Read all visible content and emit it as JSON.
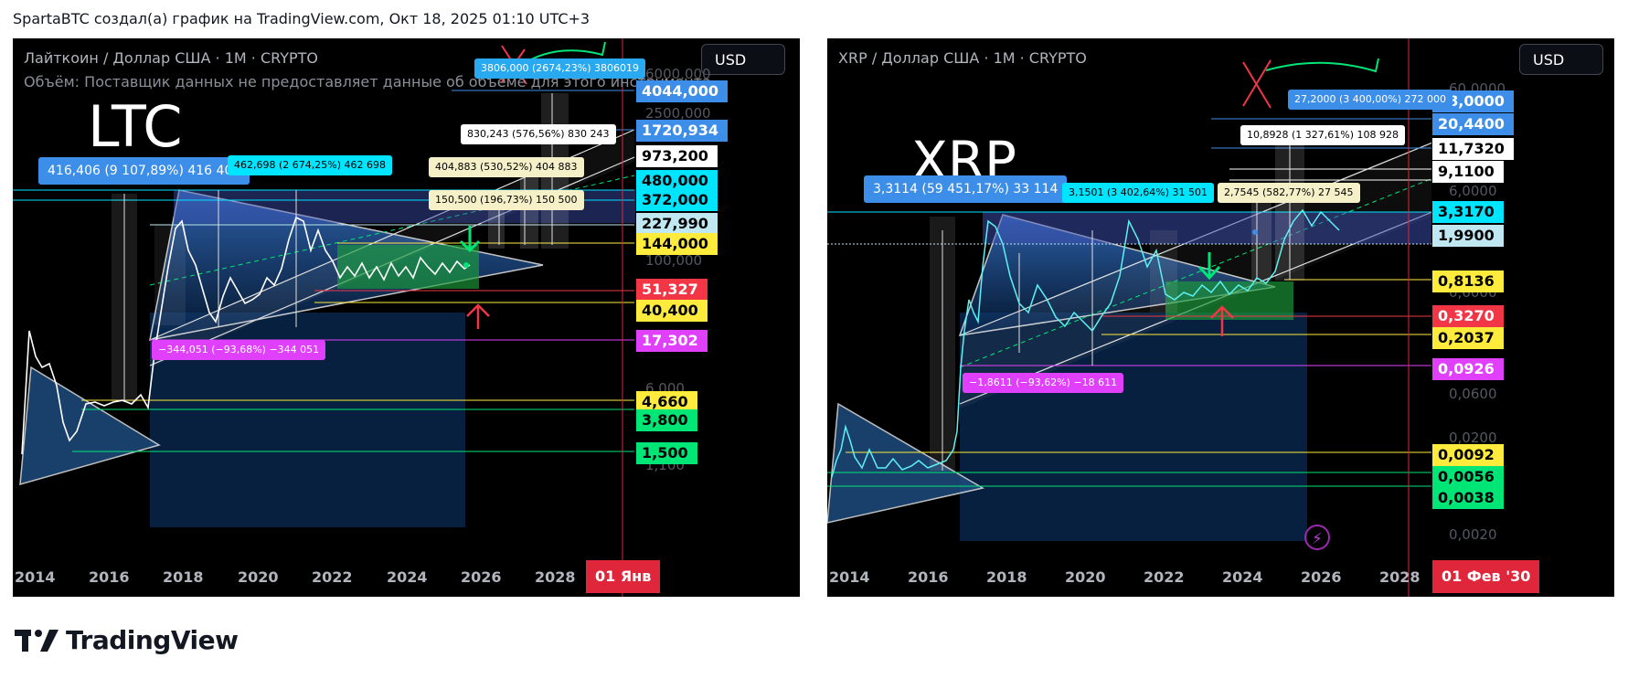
{
  "header": {
    "text": "SpartaBTC создал(а) график на TradingView.com, Окт 18, 2025 01:10 UTC+3"
  },
  "footer": {
    "brand": "TradingView",
    "logo_icon": "tradingview-logo-icon"
  },
  "colors": {
    "blue_tag": "#3d8ee8",
    "cyan_tag": "#00e5ff",
    "white_tag": "#ffffff",
    "light_cyan_tag": "#bfe8f3",
    "yellow_tag": "#ffeb3b",
    "red_tag": "#f23645",
    "green_tag": "#00e676",
    "magenta_tag": "#e040fb",
    "date_red": "#e0263b"
  },
  "ltc": {
    "symbol": "Лайткоин / Доллар США · 1M · CRYPTO",
    "volume_info": "Объём: Поставщик данных не предоставляет данные об объеме для этого инструмента.",
    "big_label": "LTC",
    "currency": "USD",
    "price_tags": [
      {
        "value": "4044,000",
        "style": "blue"
      },
      {
        "value": "1720,934",
        "style": "blue"
      },
      {
        "value": "973,200",
        "style": "white"
      },
      {
        "value": "480,000",
        "style": "cyan"
      },
      {
        "value": "372,000",
        "style": "cyan"
      },
      {
        "value": "227,990",
        "style": "lightcyan"
      },
      {
        "value": "144,000",
        "style": "yellow"
      },
      {
        "value": "51,327",
        "style": "red"
      },
      {
        "value": "40,400",
        "style": "yellow"
      },
      {
        "value": "17,302",
        "style": "magenta"
      },
      {
        "value": "4,660",
        "style": "yellow"
      },
      {
        "value": "3,800",
        "style": "green"
      },
      {
        "value": "1,500",
        "style": "green"
      }
    ],
    "axis_ticks": [
      "6000,000",
      "2500,000",
      "100,000",
      "6,000",
      "1,100"
    ],
    "years": [
      "2014",
      "2016",
      "2018",
      "2020",
      "2022",
      "2024",
      "2026",
      "2028"
    ],
    "date_marker": "01 Янв",
    "badges": [
      {
        "text": "416,406 (9 107,89%) 416 406",
        "style": "blue",
        "size": "big"
      },
      {
        "text": "462,698 (2 674,25%) 462 698",
        "style": "cyan"
      },
      {
        "text": "830,243 (576,56%) 830 243",
        "style": "white"
      },
      {
        "text": "404,883 (530,52%) 404 883",
        "style": "cream"
      },
      {
        "text": "150,500 (196,73%) 150 500",
        "style": "cream"
      },
      {
        "text": "3806,000 (2674,23%) 3806019",
        "style": "cyan"
      },
      {
        "text": "−344,051 (−93,68%) −344 051",
        "style": "magenta"
      }
    ]
  },
  "xrp": {
    "symbol": "XRP / Доллар США · 1M · CRYPTO",
    "big_label": "XRP",
    "currency": "USD",
    "price_tags": [
      {
        "value": "28,0000",
        "style": "blue"
      },
      {
        "value": "20,4400",
        "style": "blue"
      },
      {
        "value": "11,7320",
        "style": "white"
      },
      {
        "value": "9,1100",
        "style": "white"
      },
      {
        "value": "3,3170",
        "style": "cyan"
      },
      {
        "value": "1,9900",
        "style": "lightcyan"
      },
      {
        "value": "0,8136",
        "style": "yellow"
      },
      {
        "value": "0,3270",
        "style": "red"
      },
      {
        "value": "0,2037",
        "style": "yellow"
      },
      {
        "value": "0,0926",
        "style": "magenta"
      },
      {
        "value": "0,0092",
        "style": "yellow"
      },
      {
        "value": "0,0056",
        "style": "green"
      },
      {
        "value": "0,0038",
        "style": "green"
      }
    ],
    "axis_ticks": [
      "60,0000",
      "6,0000",
      "0,6000",
      "0,0600",
      "0,0200",
      "0,0020"
    ],
    "years": [
      "2014",
      "2016",
      "2018",
      "2020",
      "2022",
      "2024",
      "2026",
      "2028"
    ],
    "date_marker": "01 Фев '30",
    "badges": [
      {
        "text": "3,3114 (59 451,17%) 33 114",
        "style": "blue",
        "size": "big"
      },
      {
        "text": "3,1501 (3 402,64%) 31 501",
        "style": "cyan"
      },
      {
        "text": "2,7545 (582,77%) 27 545",
        "style": "cream"
      },
      {
        "text": "10,8928 (1 327,61%) 108 928",
        "style": "white"
      },
      {
        "text": "27,2000 (3 400,00%) 272 000",
        "style": "blue"
      },
      {
        "text": "−1,8611 (−93,62%) −18 611",
        "style": "magenta"
      }
    ]
  }
}
